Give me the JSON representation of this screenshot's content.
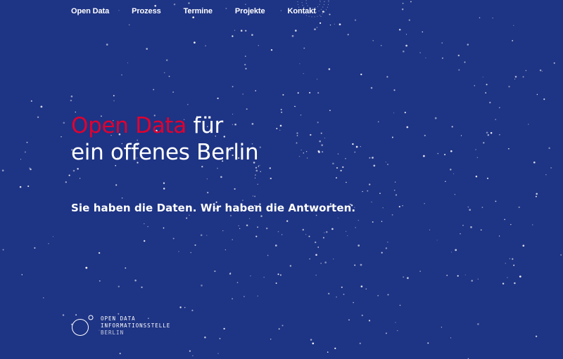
{
  "nav": {
    "items": [
      {
        "label": "Open Data"
      },
      {
        "label": "Prozess"
      },
      {
        "label": "Termine"
      },
      {
        "label": "Projekte"
      },
      {
        "label": "Kontakt"
      }
    ]
  },
  "hero": {
    "title_accent": "Open Data",
    "title_rest": " für",
    "title_line2": "ein offenes Berlin",
    "subtitle": "Sie haben die Daten. Wir haben die Antworten."
  },
  "logo": {
    "line1": "OPEN DATA",
    "line2": "INFORMATIONSSTELLE",
    "line3": "BERLIN"
  },
  "colors": {
    "background": "#1e3485",
    "accent": "#e2002e",
    "text": "#ffffff"
  }
}
